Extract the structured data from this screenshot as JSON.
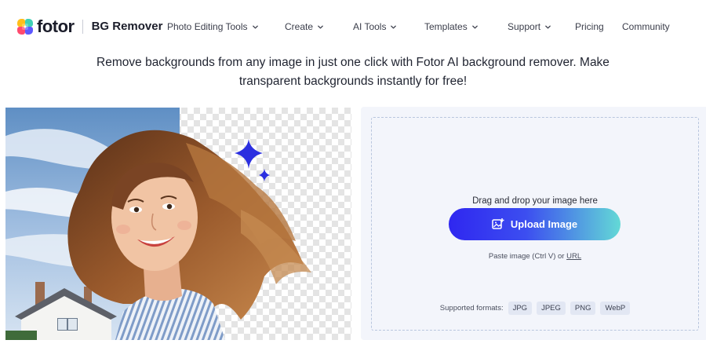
{
  "header": {
    "logo_text": "fotor",
    "product_name": "BG Remover",
    "nav": [
      {
        "label": "Photo Editing Tools",
        "has_dropdown": true
      },
      {
        "label": "Create",
        "has_dropdown": true
      },
      {
        "label": "AI Tools",
        "has_dropdown": true
      },
      {
        "label": "Templates",
        "has_dropdown": true
      },
      {
        "label": "Support",
        "has_dropdown": true
      },
      {
        "label": "Pricing",
        "has_dropdown": false
      },
      {
        "label": "Community",
        "has_dropdown": false
      }
    ]
  },
  "headline": {
    "line1": "Remove backgrounds from any image in just one click with Fotor AI background remover. Make",
    "line2": "transparent backgrounds instantly for free!"
  },
  "upload": {
    "drag_text": "Drag and drop your image here",
    "button_label": "Upload Image",
    "paste_prefix": "Paste image (Ctrl V) or ",
    "paste_link": "URL",
    "formats_label": "Supported formats:",
    "formats": [
      "JPG",
      "JPEG",
      "PNG",
      "WebP"
    ]
  },
  "colors": {
    "accent_start": "#2f27f0",
    "accent_end": "#63d9d6",
    "sparkle": "#2b2fe0",
    "panel_bg": "#f3f5fb"
  },
  "icons": {
    "nav_dropdown": "chevron-down-icon",
    "upload": "image-plus-icon",
    "sparkle": "sparkle-icon"
  }
}
